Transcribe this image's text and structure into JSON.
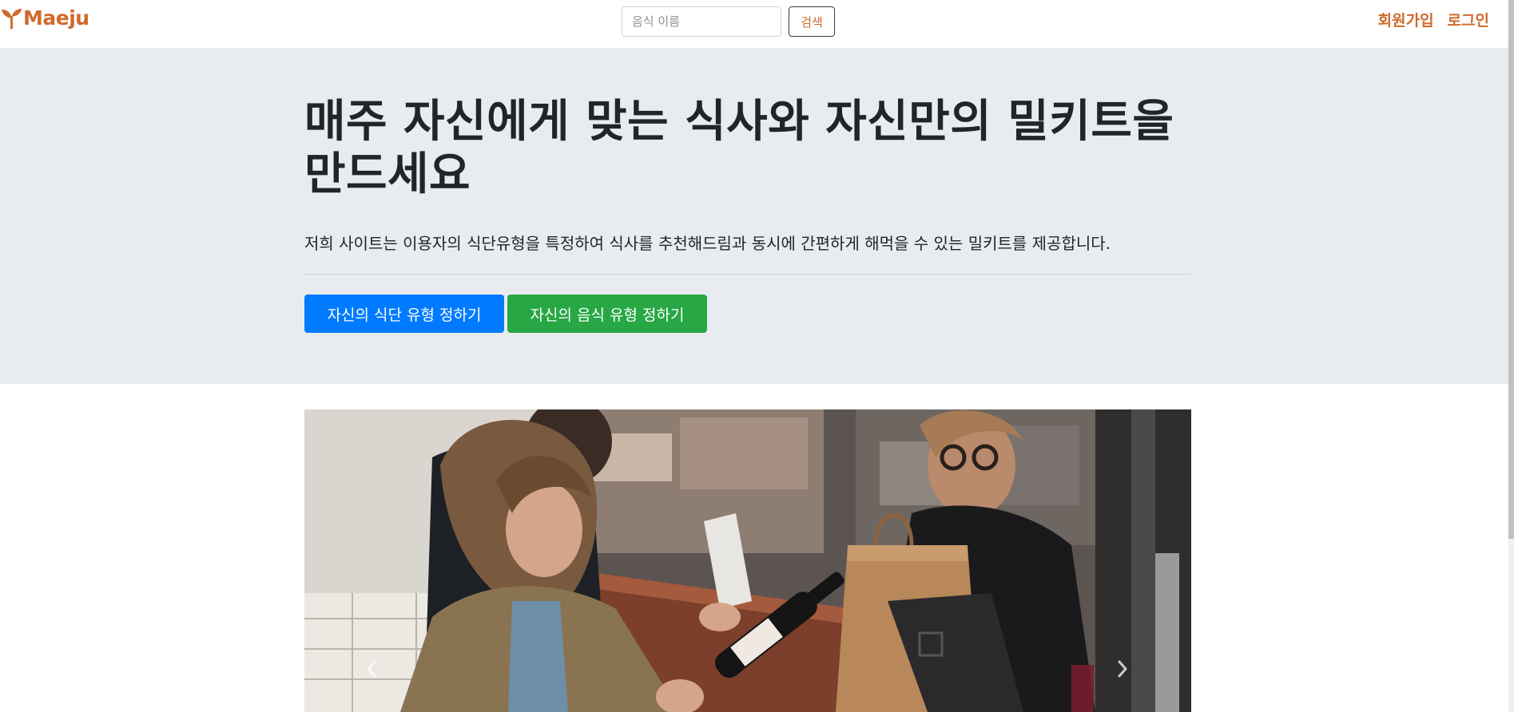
{
  "navbar": {
    "brand": "Maeju",
    "brand_icon": "sprout-icon",
    "search_placeholder": "음식 이름",
    "search_button_label": "검색",
    "links": [
      "회원가입",
      "로그인"
    ],
    "accent_color": "#cf6a2c"
  },
  "hero": {
    "heading": "매주 자신에게 맞는 식사와 자신만의 밀키트을 만드세요",
    "lead": "저희 사이트는 이용자의 식단유형을 특정하여 식사를 추천해드림과 동시에 간편하게 해먹을 수 있는 밀키트를 제공합니다.",
    "background_color": "#e9ecef",
    "buttons": [
      {
        "label": "자신의 식단 유형 정하기",
        "color": "#007bff"
      },
      {
        "label": "자신의 음식 유형 정하기",
        "color": "#28a745"
      }
    ]
  },
  "carousel": {
    "slide_image": "photo of people at a shop counter looking at a wine bottle",
    "prev_icon": "chevron-left-icon",
    "next_icon": "chevron-right-icon"
  }
}
